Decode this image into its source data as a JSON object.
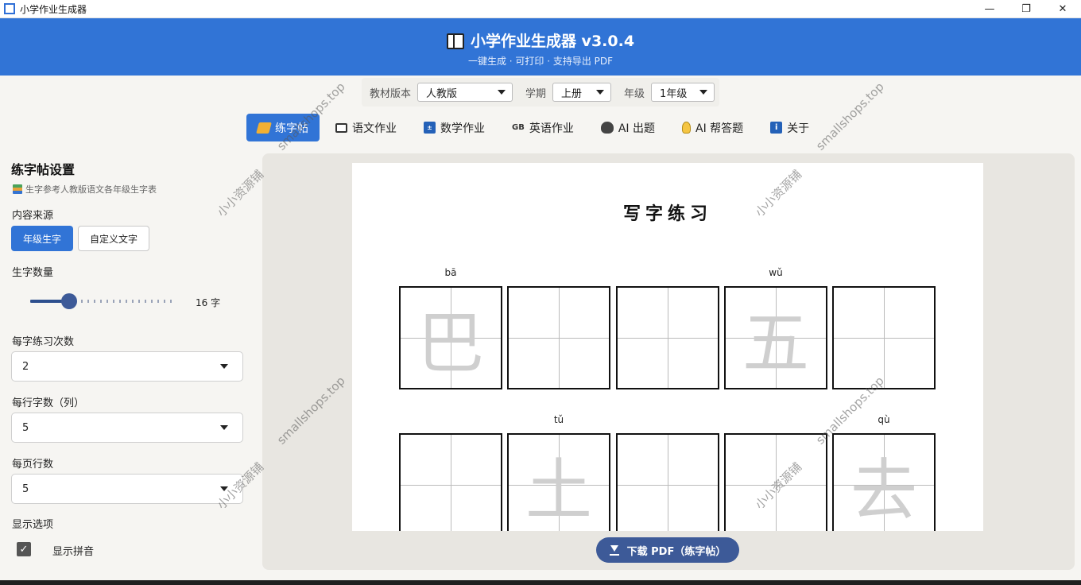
{
  "window": {
    "title": "小学作业生成器",
    "minimize": "—",
    "maximize": "❐",
    "close": "✕"
  },
  "header": {
    "title": "小学作业生成器  v3.0.4",
    "subtitle": "一键生成 · 可打印 · 支持导出 PDF"
  },
  "selectors": {
    "edition_label": "教材版本",
    "edition_value": "人教版",
    "term_label": "学期",
    "term_value": "上册",
    "grade_label": "年级",
    "grade_value": "1年级"
  },
  "tabs": [
    {
      "label": "练字帖",
      "icon": "pencil-icon",
      "active": true
    },
    {
      "label": "语文作业",
      "icon": "book-icon"
    },
    {
      "label": "数学作业",
      "icon": "calculator-icon"
    },
    {
      "label": "英语作业",
      "icon": "gb-flag-icon",
      "icon_text": "GB"
    },
    {
      "label": "AI 出题",
      "icon": "cat-icon"
    },
    {
      "label": "AI 帮答题",
      "icon": "lightbulb-icon"
    },
    {
      "label": "关于",
      "icon": "info-icon",
      "icon_text": "i"
    }
  ],
  "settings": {
    "title": "练字帖设置",
    "note": "生字参考人教版语文各年级生字表",
    "source_label": "内容来源",
    "source_options": [
      "年级生字",
      "自定义文字"
    ],
    "count_label": "生字数量",
    "count_value": 16,
    "count_max": 60,
    "count_text": "16 字",
    "repeat_label": "每字练习次数",
    "repeat_value": "2",
    "cols_label": "每行字数（列）",
    "cols_value": "5",
    "rows_label": "每页行数",
    "rows_value": "5",
    "display_label": "显示选项",
    "pinyin_label": "显示拼音",
    "pinyin_checked": true
  },
  "preview": {
    "title": "写字练习",
    "rows": [
      [
        {
          "pinyin": "bā",
          "char": "巴"
        },
        {
          "pinyin": "",
          "char": ""
        },
        {
          "pinyin": "",
          "char": ""
        },
        {
          "pinyin": "wǔ",
          "char": "五"
        },
        {
          "pinyin": "",
          "char": ""
        }
      ],
      [
        {
          "pinyin": "",
          "char": ""
        },
        {
          "pinyin": "tǔ",
          "char": "土"
        },
        {
          "pinyin": "",
          "char": ""
        },
        {
          "pinyin": "",
          "char": ""
        },
        {
          "pinyin": "qù",
          "char": "去"
        }
      ]
    ],
    "download_label": "下载 PDF（练字帖）"
  },
  "watermarks": {
    "site": "smallshops.top",
    "name": "小小资源铺"
  }
}
